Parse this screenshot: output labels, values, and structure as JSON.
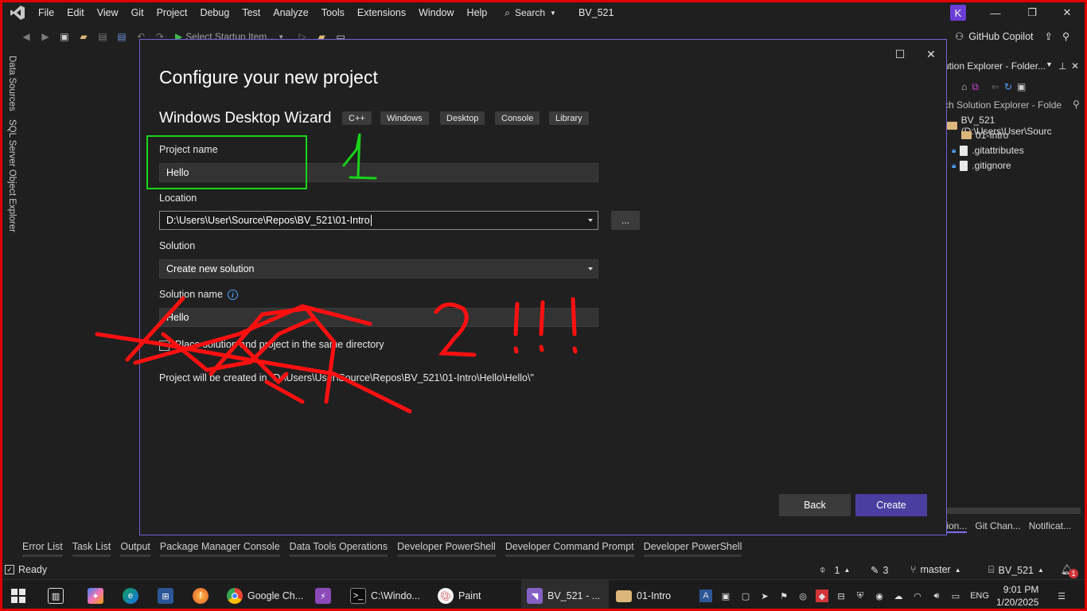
{
  "menu": [
    "File",
    "Edit",
    "View",
    "Git",
    "Project",
    "Debug",
    "Test",
    "Analyze",
    "Tools",
    "Extensions",
    "Window",
    "Help"
  ],
  "search_label": "Search",
  "solution_title": "BV_521",
  "avatar_letter": "K",
  "toolbar": {
    "startup_label": "Select Startup Item...",
    "copilot_label": "GitHub Copilot"
  },
  "left_rail": {
    "tab1": "Data Sources",
    "tab2": "SQL Server Object Explorer"
  },
  "solution_explorer": {
    "title": "ution Explorer - Folder...",
    "search_placeholder": "ch Solution Explorer - Folde",
    "root": "BV_521 (D:\\Users\\User\\Sourc",
    "items": [
      "01-Intro",
      ".gitattributes",
      ".gitignore"
    ],
    "bottom_tabs": [
      "tion...",
      "Git Chan...",
      "Notificat..."
    ]
  },
  "dialog": {
    "title": "Configure your new project",
    "template_name": "Windows Desktop Wizard",
    "tags": [
      "C++",
      "Windows",
      "Desktop",
      "Console",
      "Library"
    ],
    "project_name_label": "Project name",
    "project_name_value": "Hello",
    "location_label": "Location",
    "location_value": "D:\\Users\\User\\Source\\Repos\\BV_521\\01-Intro",
    "browse_label": "...",
    "solution_label": "Solution",
    "solution_value": "Create new solution",
    "solution_name_label": "Solution name",
    "solution_name_value": "Hello",
    "checkbox_label": "Place solution and project in the same directory",
    "path_note": "Project will be created in \"D:\\Users\\User\\Source\\Repos\\BV_521\\01-Intro\\Hello\\Hello\\\"",
    "back_label": "Back",
    "create_label": "Create"
  },
  "bottom_tabs": [
    "Error List",
    "Task List",
    "Output",
    "Package Manager Console",
    "Data Tools Operations",
    "Developer PowerShell",
    "Developer Command Prompt",
    "Developer PowerShell"
  ],
  "status": {
    "ready": "Ready",
    "up_count": "1",
    "pencil_count": "3",
    "branch": "master",
    "repo": "BV_521",
    "notif_count": "1"
  },
  "taskbar": {
    "apps": [
      "Google Ch...",
      "C:\\Windo...",
      "Paint",
      "BV_521 - ...",
      "01-Intro"
    ],
    "lang": "ENG",
    "time": "9:01 PM",
    "date": "1/20/2025"
  },
  "annotations": {
    "green_number": "1",
    "red_text": "2 !!!"
  },
  "colors": {
    "accent": "#4b3ea0",
    "dialog_border": "#6e63d8",
    "annotation_green": "#19d419",
    "annotation_red": "#ff1010"
  }
}
